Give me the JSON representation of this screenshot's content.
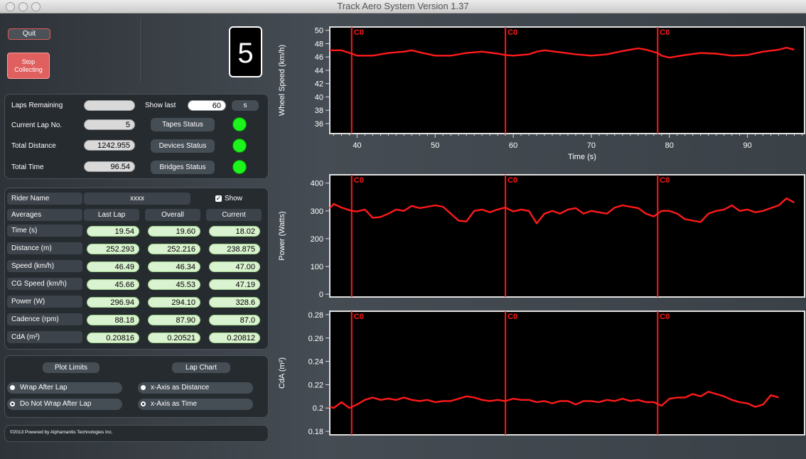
{
  "window": {
    "title": "Track Aero System Version 1.37"
  },
  "controls": {
    "quit": "Quit",
    "stop": "Stop Collecting",
    "lap_counter": "5"
  },
  "status": {
    "laps_remaining_label": "Laps Remaining",
    "laps_remaining_value": "",
    "show_last_label": "Show last",
    "show_last_value": "60",
    "show_last_unit": "s",
    "current_lap_label": "Current Lap No.",
    "current_lap_value": "5",
    "total_distance_label": "Total Distance",
    "total_distance_value": "1242.955",
    "total_time_label": "Total Time",
    "total_time_value": "96.54",
    "tapes_status": "Tapes Status",
    "devices_status": "Devices Status",
    "bridges_status": "Bridges Status",
    "led_color": "#1cf41c"
  },
  "rider": {
    "name_label": "Rider Name",
    "name_value": "xxxx",
    "show_label": "Show",
    "show_checked": true,
    "averages_label": "Averages",
    "columns": [
      "Last Lap",
      "Overall",
      "Current"
    ],
    "rows": [
      {
        "label": "Time (s)",
        "values": [
          "19.54",
          "19.60",
          "18.02"
        ]
      },
      {
        "label": "Distance (m)",
        "values": [
          "252.293",
          "252.216",
          "238.875"
        ]
      },
      {
        "label": "Speed (km/h)",
        "values": [
          "46.49",
          "46.34",
          "47.00"
        ]
      },
      {
        "label": "CG Speed (km/h)",
        "values": [
          "45.66",
          "45.53",
          "47.19"
        ]
      },
      {
        "label": "Power (W)",
        "values": [
          "296.94",
          "294.10",
          "328.6"
        ]
      },
      {
        "label": "Cadence (rpm)",
        "values": [
          "88.18",
          "87.90",
          "87.0"
        ]
      },
      {
        "label": "CdA (m²)",
        "values": [
          "0.20816",
          "0.20521",
          "0.20812"
        ]
      }
    ]
  },
  "plot": {
    "plot_limits": "Plot Limits",
    "lap_chart": "Lap Chart",
    "wrap_after_lap": "Wrap After Lap",
    "do_not_wrap": "Do Not Wrap After Lap",
    "wrap_selected": "do_not_wrap",
    "x_distance": "x-Axis as Distance",
    "x_time": "x-Axis as Time",
    "x_selected": "time"
  },
  "footer": {
    "copyright": "©2013 Powered by Alphamantis Technologies Inc."
  },
  "chart_data": [
    {
      "type": "line",
      "ylabel": "Wheel Speed (km/h)",
      "xlabel": "Time (s)",
      "xlim": [
        36.5,
        97.5
      ],
      "ylim": [
        34.5,
        50.5
      ],
      "yticks": [
        36,
        38,
        40,
        42,
        44,
        46,
        48,
        50
      ],
      "xticks": [
        40,
        50,
        60,
        70,
        80,
        90
      ],
      "grid": false,
      "line_color": "#ff1a1a",
      "markers": [
        {
          "x": 39.3,
          "label": "C0"
        },
        {
          "x": 59.0,
          "label": "C0"
        },
        {
          "x": 78.5,
          "label": "C0"
        }
      ],
      "series": [
        {
          "x": [
            36.5,
            38,
            39.3,
            40,
            42,
            44,
            46,
            47,
            48,
            50,
            52,
            54,
            56,
            58,
            59,
            60,
            62,
            63,
            64,
            66,
            68,
            70,
            72,
            74,
            76,
            77,
            78.5,
            79,
            80,
            82,
            84,
            86,
            88,
            90,
            92,
            94,
            95,
            96
          ],
          "y": [
            47.0,
            47.0,
            46.5,
            46.2,
            46.2,
            46.6,
            46.8,
            47.0,
            46.7,
            46.2,
            46.2,
            46.6,
            46.8,
            46.5,
            46.3,
            46.2,
            46.4,
            46.8,
            47.0,
            46.7,
            46.4,
            46.2,
            46.4,
            46.9,
            47.3,
            47.1,
            46.6,
            46.2,
            45.9,
            46.3,
            46.6,
            46.5,
            46.2,
            46.3,
            46.8,
            47.1,
            47.4,
            47.1
          ]
        }
      ]
    },
    {
      "type": "line",
      "ylabel": "Power (Watts)",
      "xlim": [
        36.5,
        97.5
      ],
      "ylim": [
        -10,
        430
      ],
      "yticks": [
        0,
        100,
        200,
        300,
        400
      ],
      "grid": false,
      "line_color": "#ff1a1a",
      "markers": [
        {
          "x": 39.3,
          "label": "C0"
        },
        {
          "x": 59.0,
          "label": "C0"
        },
        {
          "x": 78.5,
          "label": "C0"
        }
      ],
      "series": [
        {
          "x": [
            36.5,
            37,
            38,
            39.3,
            40,
            41,
            42,
            43,
            44,
            45,
            46,
            47,
            48,
            49,
            50,
            51,
            52,
            53,
            54,
            55,
            56,
            57,
            58,
            59,
            60,
            61,
            62,
            63,
            64,
            65,
            66,
            67,
            68,
            69,
            70,
            71,
            72,
            73,
            74,
            75,
            76,
            77,
            78,
            79,
            80,
            81,
            82,
            83,
            84,
            85,
            86,
            87,
            88,
            89,
            90,
            91,
            92,
            93,
            94,
            95,
            96
          ],
          "y": [
            310,
            325,
            312,
            300,
            298,
            305,
            275,
            278,
            290,
            305,
            300,
            318,
            310,
            315,
            320,
            315,
            290,
            265,
            262,
            300,
            305,
            295,
            305,
            312,
            298,
            305,
            300,
            255,
            290,
            300,
            290,
            305,
            310,
            290,
            300,
            295,
            290,
            312,
            320,
            315,
            310,
            290,
            280,
            300,
            300,
            290,
            270,
            265,
            260,
            290,
            300,
            305,
            320,
            300,
            305,
            295,
            300,
            310,
            320,
            345,
            330
          ]
        }
      ]
    },
    {
      "type": "line",
      "ylabel": "CdA (m²)",
      "xlim": [
        36.5,
        97.5
      ],
      "ylim": [
        0.177,
        0.283
      ],
      "yticks": [
        0.18,
        0.2,
        0.22,
        0.24,
        0.26,
        0.28
      ],
      "grid": false,
      "line_color": "#ff1a1a",
      "markers": [
        {
          "x": 39.3,
          "label": "C0"
        },
        {
          "x": 59.0,
          "label": "C0"
        },
        {
          "x": 78.5,
          "label": "C0"
        }
      ],
      "series": [
        {
          "x": [
            36.5,
            37,
            38,
            39,
            40,
            41,
            42,
            43,
            44,
            45,
            46,
            47,
            48,
            49,
            50,
            51,
            52,
            53,
            54,
            55,
            56,
            57,
            58,
            59,
            60,
            61,
            62,
            63,
            64,
            65,
            66,
            67,
            68,
            69,
            70,
            71,
            72,
            73,
            74,
            75,
            76,
            77,
            78,
            79,
            80,
            81,
            82,
            83,
            84,
            85,
            86,
            87,
            88,
            89,
            90,
            91,
            92,
            93,
            94
          ],
          "y": [
            0.201,
            0.2,
            0.205,
            0.2,
            0.203,
            0.207,
            0.209,
            0.207,
            0.208,
            0.207,
            0.209,
            0.207,
            0.206,
            0.207,
            0.205,
            0.206,
            0.206,
            0.208,
            0.21,
            0.209,
            0.207,
            0.206,
            0.207,
            0.206,
            0.208,
            0.207,
            0.207,
            0.205,
            0.206,
            0.204,
            0.206,
            0.206,
            0.203,
            0.206,
            0.206,
            0.205,
            0.207,
            0.206,
            0.208,
            0.206,
            0.207,
            0.205,
            0.205,
            0.202,
            0.208,
            0.209,
            0.209,
            0.212,
            0.21,
            0.214,
            0.212,
            0.21,
            0.207,
            0.205,
            0.204,
            0.201,
            0.203,
            0.211,
            0.209
          ]
        }
      ]
    }
  ]
}
